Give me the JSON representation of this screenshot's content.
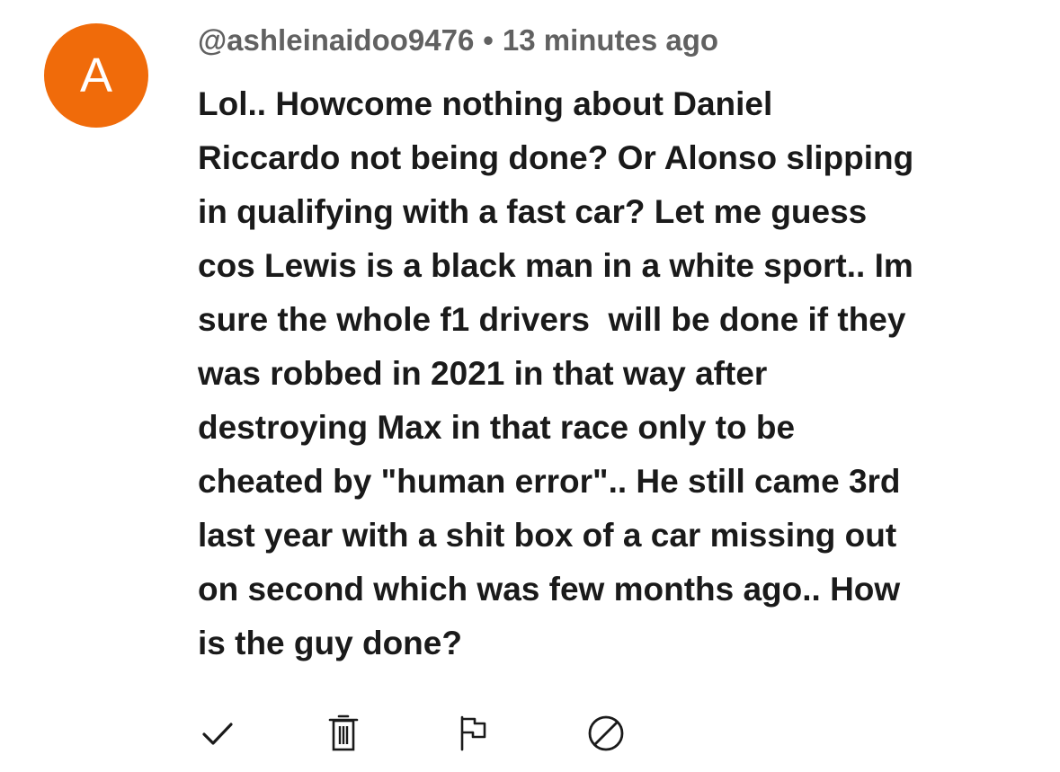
{
  "comment": {
    "avatar_letter": "A",
    "avatar_color": "#f06b0a",
    "username": "@ashleinaidoo9476",
    "separator": "•",
    "timestamp": "13 minutes ago",
    "lines": [
      "Lol.. Howcome nothing about Daniel",
      "Riccardo not being done? Or Alonso slipping",
      "in qualifying with a fast car? Let me guess",
      "cos Lewis is a black man in a white sport.. Im",
      "sure the whole f1 drivers  will be done if they",
      "was robbed in 2021 in that way after",
      "destroying Max in that race only to be",
      "cheated by \"human error\".. He still came 3rd",
      "last year with a shit box of a car missing out",
      "on second which was few months ago.. How",
      "is the guy done?"
    ]
  },
  "actions": [
    {
      "name": "approve",
      "icon": "check-icon"
    },
    {
      "name": "delete",
      "icon": "trash-icon"
    },
    {
      "name": "report",
      "icon": "flag-icon"
    },
    {
      "name": "block",
      "icon": "block-icon"
    }
  ]
}
